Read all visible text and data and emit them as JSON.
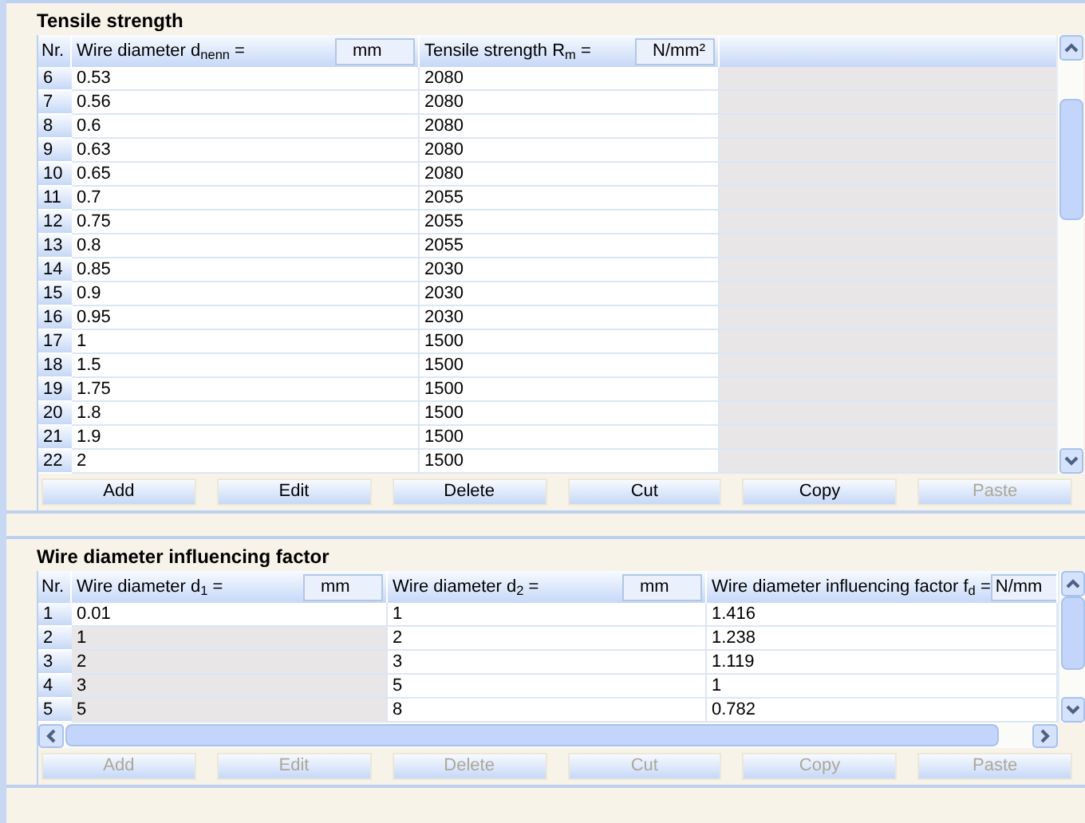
{
  "sections": [
    {
      "title": "Tensile strength",
      "table": {
        "nr_label": "Nr.",
        "columns": [
          {
            "label": "Wire diameter d$_{nenn}$ =",
            "unit": "mm"
          },
          {
            "label": "Tensile strength R$_{m}$ =",
            "unit": "N/mm²"
          }
        ],
        "rows": [
          {
            "nr": "6",
            "cells": [
              {
                "text": "0.53",
                "disabled": false
              },
              {
                "text": "2080",
                "disabled": false
              }
            ]
          },
          {
            "nr": "7",
            "cells": [
              {
                "text": "0.56",
                "disabled": false
              },
              {
                "text": "2080",
                "disabled": false
              }
            ]
          },
          {
            "nr": "8",
            "cells": [
              {
                "text": "0.6",
                "disabled": false
              },
              {
                "text": "2080",
                "disabled": false
              }
            ]
          },
          {
            "nr": "9",
            "cells": [
              {
                "text": "0.63",
                "disabled": false
              },
              {
                "text": "2080",
                "disabled": false
              }
            ]
          },
          {
            "nr": "10",
            "cells": [
              {
                "text": "0.65",
                "disabled": false
              },
              {
                "text": "2080",
                "disabled": false
              }
            ]
          },
          {
            "nr": "11",
            "cells": [
              {
                "text": "0.7",
                "disabled": false
              },
              {
                "text": "2055",
                "disabled": false
              }
            ]
          },
          {
            "nr": "12",
            "cells": [
              {
                "text": "0.75",
                "disabled": false
              },
              {
                "text": "2055",
                "disabled": false
              }
            ]
          },
          {
            "nr": "13",
            "cells": [
              {
                "text": "0.8",
                "disabled": false
              },
              {
                "text": "2055",
                "disabled": false
              }
            ]
          },
          {
            "nr": "14",
            "cells": [
              {
                "text": "0.85",
                "disabled": false
              },
              {
                "text": "2030",
                "disabled": false
              }
            ]
          },
          {
            "nr": "15",
            "cells": [
              {
                "text": "0.9",
                "disabled": false
              },
              {
                "text": "2030",
                "disabled": false
              }
            ]
          },
          {
            "nr": "16",
            "cells": [
              {
                "text": "0.95",
                "disabled": false
              },
              {
                "text": "2030",
                "disabled": false
              }
            ]
          },
          {
            "nr": "17",
            "cells": [
              {
                "text": "1",
                "disabled": false
              },
              {
                "text": "1500",
                "disabled": false
              }
            ]
          },
          {
            "nr": "18",
            "cells": [
              {
                "text": "1.5",
                "disabled": false
              },
              {
                "text": "1500",
                "disabled": false
              }
            ]
          },
          {
            "nr": "19",
            "cells": [
              {
                "text": "1.75",
                "disabled": false
              },
              {
                "text": "1500",
                "disabled": false
              }
            ]
          },
          {
            "nr": "20",
            "cells": [
              {
                "text": "1.8",
                "disabled": false
              },
              {
                "text": "1500",
                "disabled": false
              }
            ]
          },
          {
            "nr": "21",
            "cells": [
              {
                "text": "1.9",
                "disabled": false
              },
              {
                "text": "1500",
                "disabled": false
              }
            ]
          },
          {
            "nr": "22",
            "cells": [
              {
                "text": "2",
                "disabled": false
              },
              {
                "text": "1500",
                "disabled": false
              }
            ]
          }
        ]
      },
      "buttons": [
        {
          "label": "Add",
          "disabled": false
        },
        {
          "label": "Edit",
          "disabled": false
        },
        {
          "label": "Delete",
          "disabled": false
        },
        {
          "label": "Cut",
          "disabled": false
        },
        {
          "label": "Copy",
          "disabled": false
        },
        {
          "label": "Paste",
          "disabled": true
        }
      ]
    },
    {
      "title": "Wire diameter influencing factor",
      "table": {
        "nr_label": "Nr.",
        "columns": [
          {
            "label": "Wire diameter d$_{1}$ =",
            "unit": "mm"
          },
          {
            "label": "Wire diameter d$_{2}$ =",
            "unit": "mm"
          },
          {
            "label": "Wire diameter influencing factor f$_{d}$ =",
            "unit": "N/mm"
          }
        ],
        "rows": [
          {
            "nr": "1",
            "cells": [
              {
                "text": "0.01",
                "disabled": false
              },
              {
                "text": "1",
                "disabled": false
              },
              {
                "text": "1.416",
                "disabled": false
              }
            ]
          },
          {
            "nr": "2",
            "cells": [
              {
                "text": "1",
                "disabled": true
              },
              {
                "text": "2",
                "disabled": false
              },
              {
                "text": "1.238",
                "disabled": false
              }
            ]
          },
          {
            "nr": "3",
            "cells": [
              {
                "text": "2",
                "disabled": true
              },
              {
                "text": "3",
                "disabled": false
              },
              {
                "text": "1.119",
                "disabled": false
              }
            ]
          },
          {
            "nr": "4",
            "cells": [
              {
                "text": "3",
                "disabled": true
              },
              {
                "text": "5",
                "disabled": false
              },
              {
                "text": "1",
                "disabled": false
              }
            ]
          },
          {
            "nr": "5",
            "cells": [
              {
                "text": "5",
                "disabled": true
              },
              {
                "text": "8",
                "disabled": false
              },
              {
                "text": "0.782",
                "disabled": false
              }
            ]
          }
        ]
      },
      "buttons": [
        {
          "label": "Add",
          "disabled": true
        },
        {
          "label": "Edit",
          "disabled": true
        },
        {
          "label": "Delete",
          "disabled": true
        },
        {
          "label": "Cut",
          "disabled": true
        },
        {
          "label": "Copy",
          "disabled": true
        },
        {
          "label": "Paste",
          "disabled": true
        }
      ]
    }
  ]
}
